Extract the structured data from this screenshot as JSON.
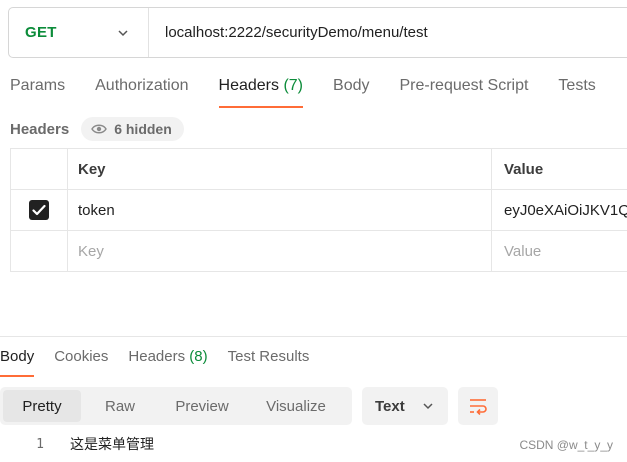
{
  "request": {
    "method": "GET",
    "url": "localhost:2222/securityDemo/menu/test"
  },
  "request_tabs": [
    {
      "label": "Params"
    },
    {
      "label": "Authorization"
    },
    {
      "label": "Headers",
      "count": "(7)"
    },
    {
      "label": "Body"
    },
    {
      "label": "Pre-request Script"
    },
    {
      "label": "Tests"
    }
  ],
  "headers": {
    "label": "Headers",
    "hidden_pill": "6 hidden",
    "columns": {
      "key": "Key",
      "value": "Value"
    },
    "rows": [
      {
        "checked": true,
        "key": "token",
        "value": "eyJ0eXAiOiJKV1Q"
      }
    ],
    "placeholder_row": {
      "key": "Key",
      "value": "Value"
    }
  },
  "response_tabs": [
    {
      "label": "Body"
    },
    {
      "label": "Cookies"
    },
    {
      "label": "Headers",
      "count": "(8)"
    },
    {
      "label": "Test Results"
    }
  ],
  "view_buttons": [
    "Pretty",
    "Raw",
    "Preview",
    "Visualize"
  ],
  "format_select": "Text",
  "response_body": {
    "line_number": "1",
    "content": "这是菜单管理"
  },
  "watermark": "CSDN @w_t_y_y",
  "colors": {
    "accent": "#ff6c37",
    "method_get": "#0c8c3a"
  }
}
